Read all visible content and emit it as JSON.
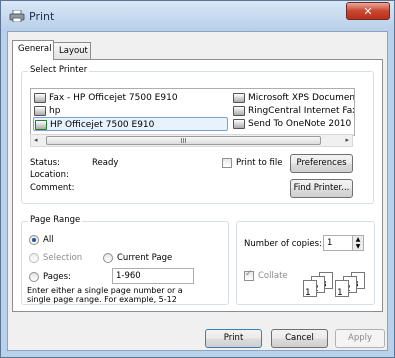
{
  "window": {
    "title": "Print",
    "close_label": "✕"
  },
  "tabs": [
    {
      "label": "General"
    },
    {
      "label": "Layout"
    }
  ],
  "select_printer": {
    "group_label": "Select Printer",
    "printers_left": [
      "Fax - HP Officejet 7500 E910",
      "hp",
      "HP Officejet 7500 E910"
    ],
    "printers_right": [
      "Microsoft XPS Document Writer",
      "RingCentral Internet Fax",
      "Send To OneNote 2010"
    ],
    "selected": "HP Officejet 7500 E910",
    "scroll_grip": "III"
  },
  "status": {
    "status_label": "Status:",
    "status_value": "Ready",
    "location_label": "Location:",
    "comment_label": "Comment:",
    "print_to_file_label": "Print to file",
    "preferences_label": "Preferences",
    "find_printer_label": "Find Printer..."
  },
  "page_range": {
    "group_label": "Page Range",
    "all_label": "All",
    "selection_label": "Selection",
    "current_page_label": "Current Page",
    "pages_label": "Pages:",
    "pages_value": "1-960",
    "hint": "Enter either a single page number or a single page range.  For example, 5-12",
    "selected": "All"
  },
  "copies": {
    "number_label": "Number of copies:",
    "number_value": "1",
    "collate_label": "Collate",
    "collate_checked": true
  },
  "buttons": {
    "print": "Print",
    "cancel": "Cancel",
    "apply": "Apply"
  }
}
